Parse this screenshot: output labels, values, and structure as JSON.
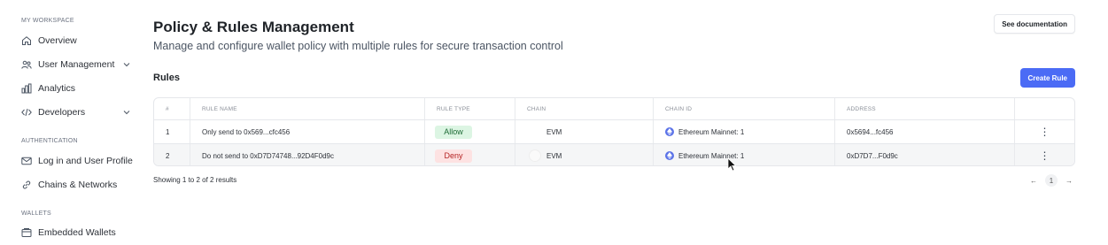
{
  "sidebar": {
    "workspace_label": "MY WORKSPACE",
    "auth_label": "AUTHENTICATION",
    "wallets_label": "WALLETS",
    "items": [
      {
        "label": "Overview",
        "icon": "home-icon"
      },
      {
        "label": "User Management",
        "icon": "users-icon"
      },
      {
        "label": "Analytics",
        "icon": "analytics-icon"
      },
      {
        "label": "Developers",
        "icon": "code-icon"
      },
      {
        "label": "Log in and User Profile",
        "icon": "mail-icon"
      },
      {
        "label": "Chains & Networks",
        "icon": "link-icon"
      },
      {
        "label": "Embedded Wallets",
        "icon": "wallet-icon"
      }
    ]
  },
  "header": {
    "title": "Policy & Rules Management",
    "subtitle": "Manage and configure wallet policy with multiple rules for secure transaction control",
    "doc_button": "See documentation"
  },
  "rules": {
    "heading": "Rules",
    "create_button": "Create Rule",
    "columns": [
      "#",
      "RULE NAME",
      "RULE TYPE",
      "CHAIN",
      "CHAIN ID",
      "ADDRESS"
    ],
    "rows": [
      {
        "num": "1",
        "name": "Only send to 0x569...cfc456",
        "type": "Allow",
        "chain": "EVM",
        "chain_id": "Ethereum Mainnet: 1",
        "address": "0x5694...fc456"
      },
      {
        "num": "2",
        "name": "Do not send to 0xD7D74748...92D4F0d9c",
        "type": "Deny",
        "chain": "EVM",
        "chain_id": "Ethereum Mainnet: 1",
        "address": "0xD7D7...F0d9c"
      }
    ],
    "showing": "Showing 1 to 2 of 2 results",
    "pager": {
      "prev": "←",
      "current": "1",
      "next": "→"
    }
  },
  "colors": {
    "accent": "#4b6bf5",
    "allow_bg": "#dcf5e3",
    "allow_text": "#1d6b35",
    "deny_bg": "#fde2e2",
    "deny_text": "#b42323",
    "ethereum": "#5b73e8"
  }
}
